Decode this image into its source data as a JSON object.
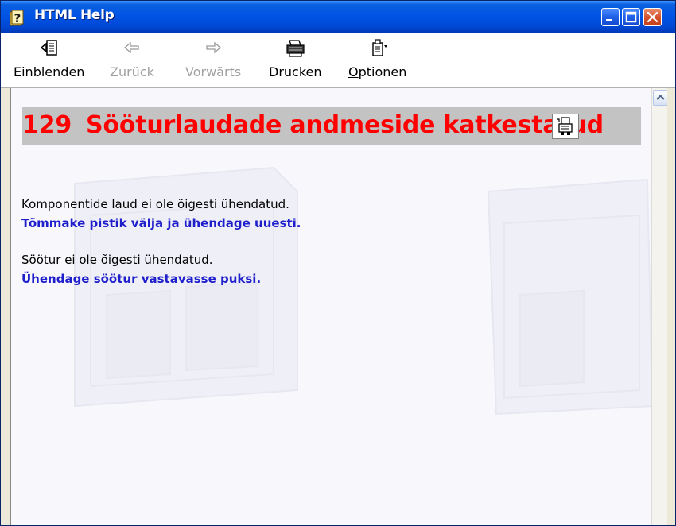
{
  "window": {
    "title": "HTML Help"
  },
  "toolbar": {
    "show_label": "Einblenden",
    "back_label": "Zurück",
    "forward_label": "Vorwärts",
    "print_label": "Drucken",
    "options_label_first": "O",
    "options_label_rest": "ptionen"
  },
  "content": {
    "error_number": "129",
    "error_title": "Sööturlaudade andmeside katkestatud",
    "items": [
      {
        "cause": "Komponentide laud ei ole õigesti ühendatud.",
        "action": "Tõmmake pistik välja ja ühendage uuesti."
      },
      {
        "cause": "Söötur ei ole õigesti ühendatud.",
        "action": "Ühendage söötur vastavasse puksi."
      }
    ]
  },
  "colors": {
    "heading_text": "#ff0000",
    "heading_bar": "#c3c3c3",
    "action_text": "#1f1fcc",
    "titlebar": "#0055e5"
  }
}
